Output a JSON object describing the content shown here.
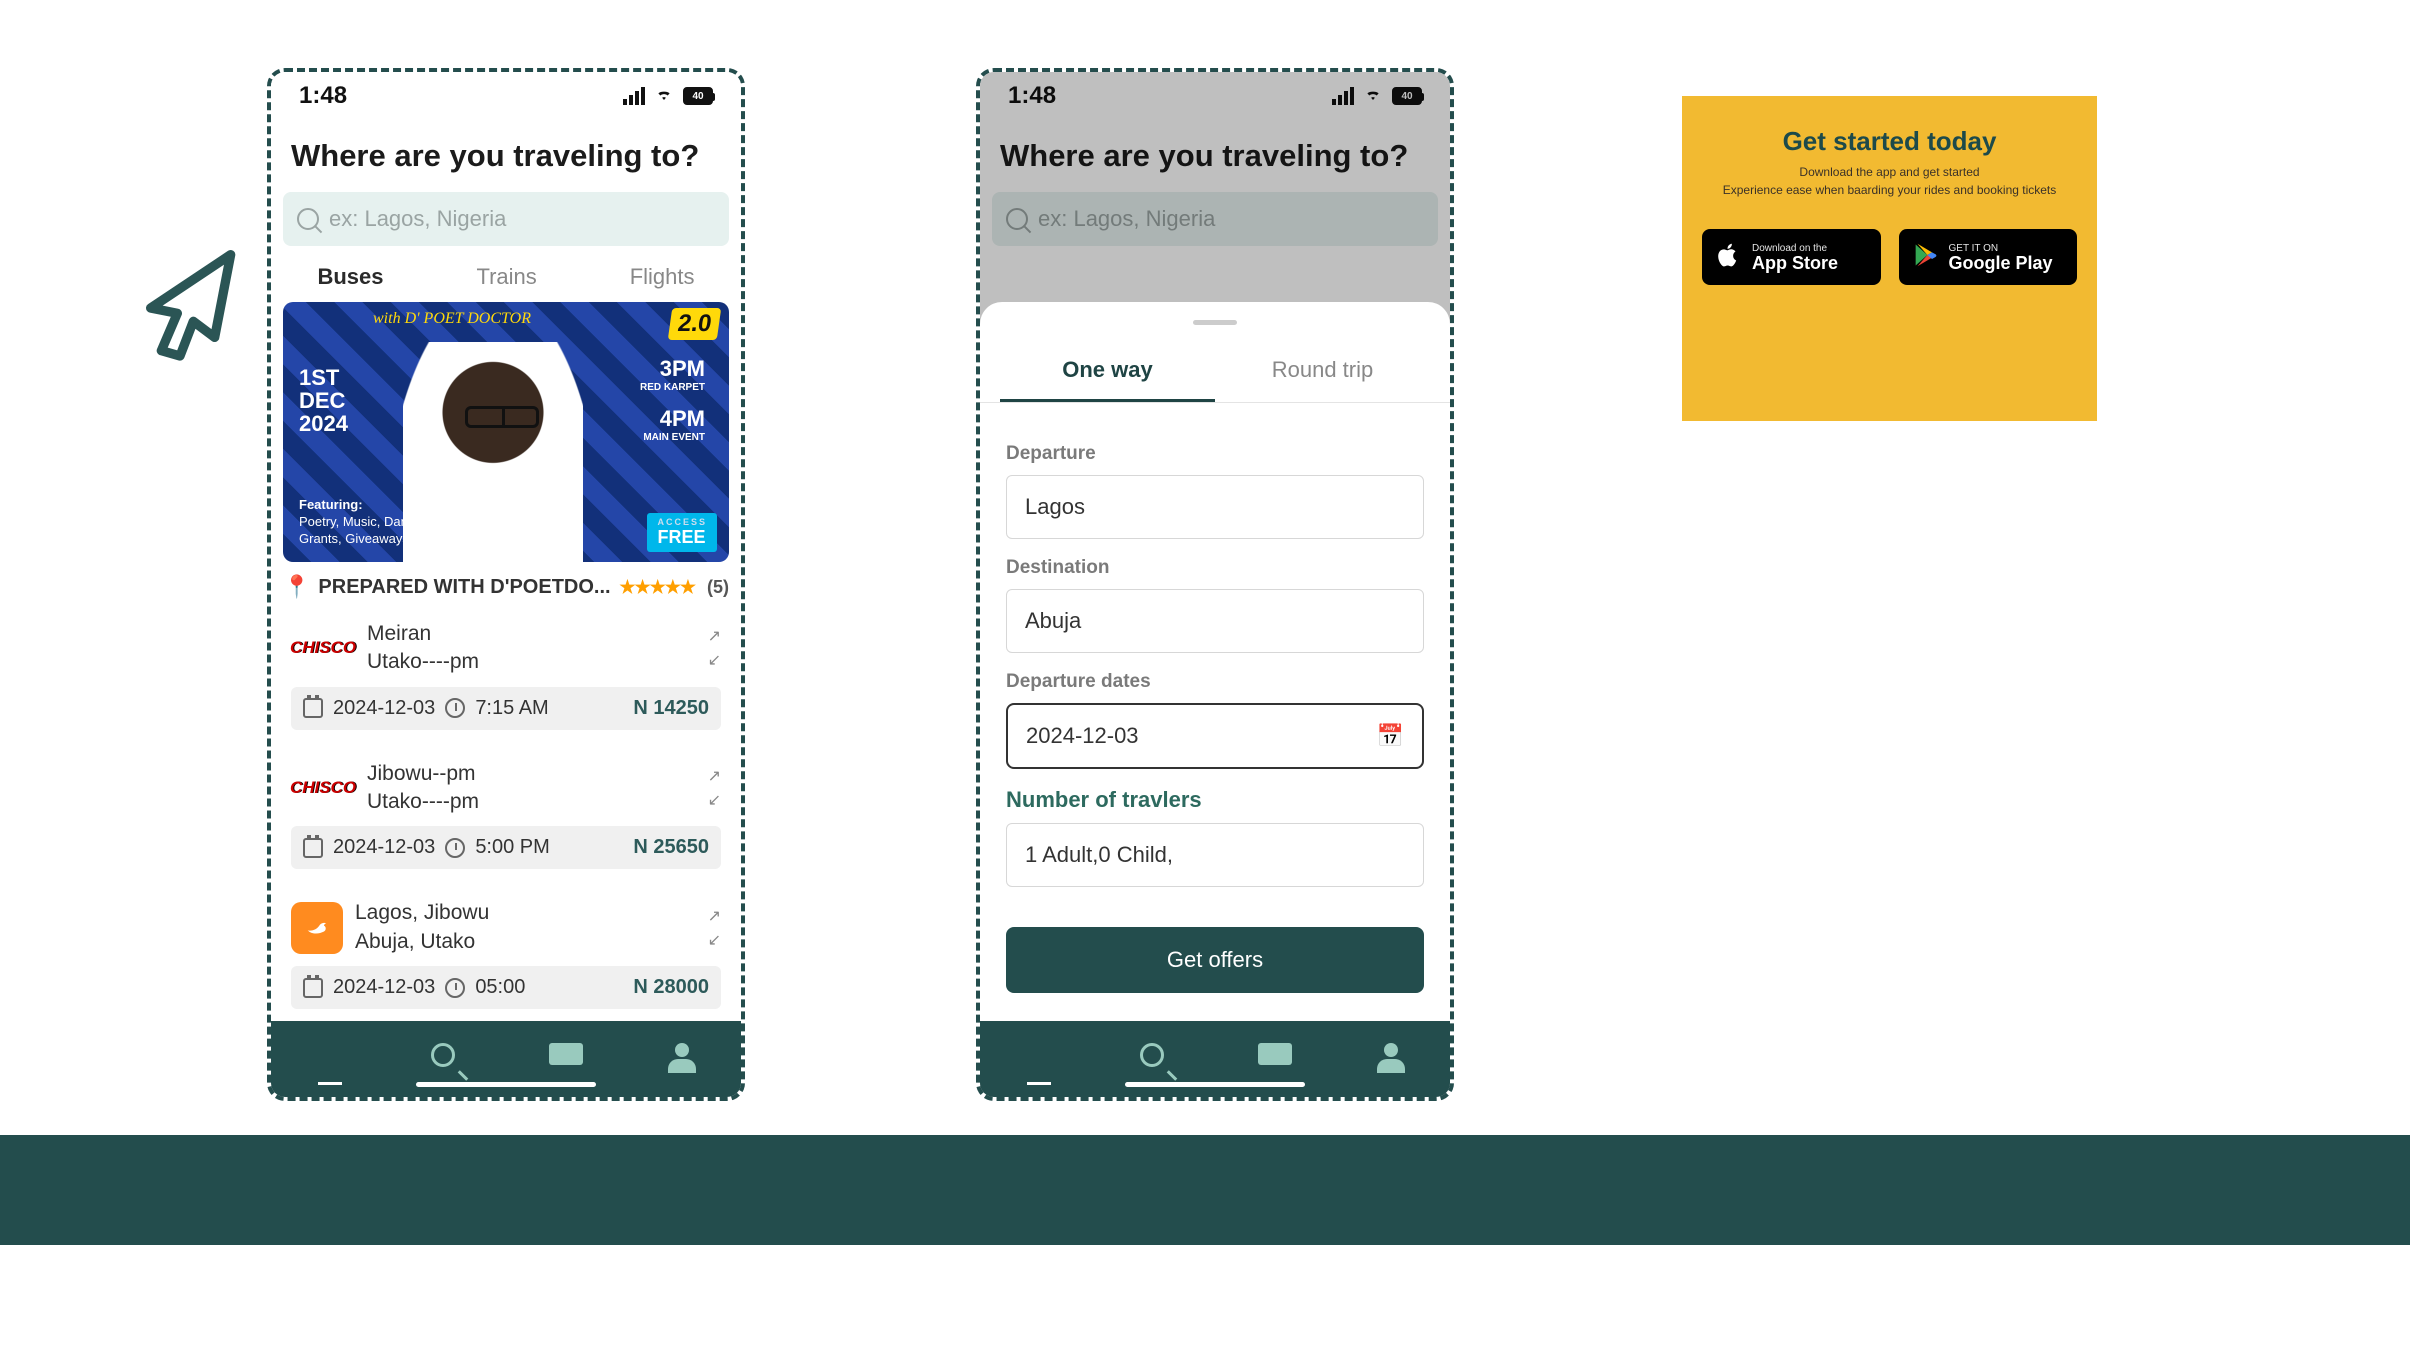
{
  "status": {
    "time": "1:48",
    "batt": "40"
  },
  "heading": "Where are you traveling to?",
  "search_placeholder": "ex: Lagos, Nigeria",
  "modes": {
    "buses": "Buses",
    "trains": "Trains",
    "flights": "Flights"
  },
  "promo": {
    "sub": "with D' POET DOCTOR",
    "tag": "2.0",
    "date_line1": "1ST",
    "date_line2": "DEC",
    "date_line3": "2024",
    "time1": "3PM",
    "time1_sub": "RED KARPET",
    "time2": "4PM",
    "time2_sub": "MAIN EVENT",
    "feat_head": "Featuring:",
    "feat_body": "Poetry, Music, Dance, Grants, Giveaways and",
    "free": "FREE"
  },
  "event": {
    "title": "PREPARED WITH D'POETDO...",
    "stars": "★★★★★",
    "count": "(5)"
  },
  "routes": [
    {
      "operator": "CHISCO",
      "from": "Meiran",
      "to": "Utako----pm",
      "date": "2024-12-03",
      "time": "7:15 AM",
      "price": "N 14250"
    },
    {
      "operator": "CHISCO",
      "from": "Jibowu--pm",
      "to": "Utako----pm",
      "date": "2024-12-03",
      "time": "5:00 PM",
      "price": "N 25650"
    },
    {
      "operator": "orange",
      "from": "Lagos, Jibowu",
      "to": "Abuja, Utako",
      "date": "2024-12-03",
      "time": "05:00",
      "price": "N 28000"
    }
  ],
  "sheet": {
    "tab_oneway": "One way",
    "tab_round": "Round trip",
    "lab_departure": "Departure",
    "val_departure": "Lagos",
    "lab_destination": "Destination",
    "val_destination": "Abuja",
    "lab_dates": "Departure dates",
    "val_date": "2024-12-03",
    "lab_travelers": "Number of travlers",
    "val_travelers": "1 Adult,0 Child,",
    "btn": "Get offers"
  },
  "card": {
    "title": "Get started today",
    "line1": "Download the app and get started",
    "line2": "Experience ease when baarding your rides and booking tickets",
    "apple_small": "Download on the",
    "apple_big": "App Store",
    "play_small": "GET IT ON",
    "play_big": "Google Play"
  }
}
